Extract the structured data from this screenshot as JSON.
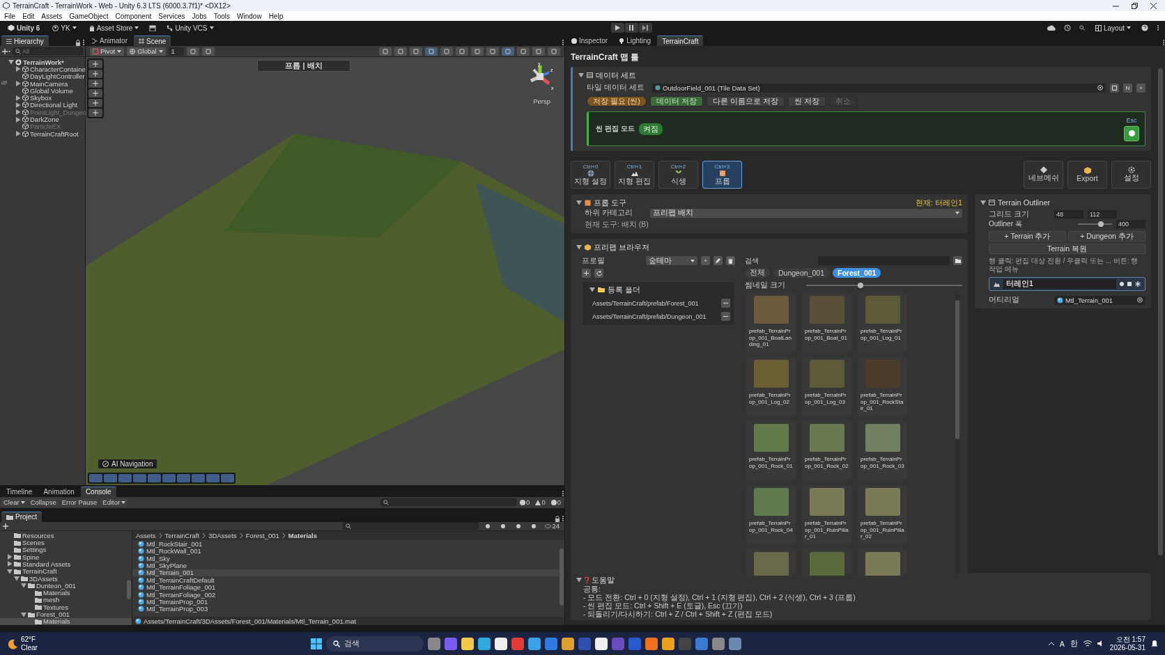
{
  "window": {
    "title": "TerrainCraft - TerrainWork - Web - Unity 6.3 LTS (6000.3.7f1)* <DX12>"
  },
  "menu": [
    "File",
    "Edit",
    "Assets",
    "GameObject",
    "Component",
    "Services",
    "Jobs",
    "Tools",
    "Window",
    "Help"
  ],
  "toolbar": {
    "product": "Unity 6",
    "account": "YK",
    "asset_store": "Asset Store",
    "vcs": "Unity VCS",
    "layout": "Layout"
  },
  "hierarchy": {
    "tab": "Hierarchy",
    "search_placeholder": "All",
    "root": {
      "label": "TerrainWork*",
      "expanded": true,
      "disabled": false,
      "children": [
        {
          "label": "CharacterContaine",
          "expanded": false,
          "disabled": false
        },
        {
          "label": "DayLightController",
          "disabled": false
        },
        {
          "label": "MainCamera",
          "expanded": false,
          "disabled": false
        },
        {
          "label": "Global Volume",
          "disabled": false
        },
        {
          "label": "Skybox",
          "expanded": false,
          "disabled": false
        },
        {
          "label": "Directional Light",
          "expanded": false,
          "disabled": false
        },
        {
          "label": "PointLight_Dungeo",
          "expanded": false,
          "disabled": true
        },
        {
          "label": "DarkZone",
          "expanded": false,
          "disabled": false
        },
        {
          "label": "ParticleEX",
          "disabled": true
        },
        {
          "label": "TerrainCraftRoot",
          "expanded": false,
          "disabled": false
        }
      ]
    }
  },
  "scene_tabs": [
    {
      "label": "Animator",
      "selected": false
    },
    {
      "label": "Scene",
      "selected": true
    }
  ],
  "scene_toolbar": {
    "pivot": "Pivot",
    "space": "Global",
    "grid_step": "1"
  },
  "scene_view": {
    "mode_label": "프롭 | 배치",
    "projection": "Persp",
    "axes": [
      "y",
      "z",
      "x"
    ],
    "overlay": "AI Navigation"
  },
  "console": {
    "tabs": [
      {
        "label": "Timeline",
        "selected": false
      },
      {
        "label": "Animation",
        "selected": false
      },
      {
        "label": "Console",
        "selected": true
      }
    ],
    "buttons": [
      "Clear",
      "Collapse",
      "Error Pause",
      "Editor"
    ],
    "counts": [
      "0",
      "0",
      "0"
    ]
  },
  "project": {
    "tab": "Project",
    "visible_count": "24",
    "tree": [
      {
        "label": "Resources",
        "selected": false
      },
      {
        "label": "Scenes",
        "selected": false
      },
      {
        "label": "Settings",
        "selected": false
      },
      {
        "label": "Spine",
        "expanded": false,
        "selected": false
      },
      {
        "label": "Standard Assets",
        "expanded": false,
        "selected": false
      },
      {
        "label": "TerrainCraft",
        "expanded": true,
        "selected": false,
        "children": [
          {
            "label": "3DAssets",
            "expanded": true,
            "selected": false,
            "children": [
              {
                "label": "Dunteon_001",
                "expanded": true,
                "selected": false,
                "children": [
                  {
                    "label": "Materials",
                    "selected": false
                  },
                  {
                    "label": "mesh",
                    "selected": false
                  },
                  {
                    "label": "Textures",
                    "selected": false
                  }
                ]
              },
              {
                "label": "Forest_001",
                "expanded": true,
                "selected": false,
                "children": [
                  {
                    "label": "Materials",
                    "selected": true
                  }
                ]
              }
            ]
          }
        ]
      }
    ],
    "breadcrumb": [
      "Assets",
      "TerrainCraft",
      "3DAssets",
      "Forest_001",
      "Materials"
    ],
    "files": [
      {
        "name": "Mtl_RockStair_001",
        "selected": false
      },
      {
        "name": "Mtl_RockWall_001",
        "selected": false
      },
      {
        "name": "Mtl_Sky",
        "selected": false
      },
      {
        "name": "Mtl_SkyPlane",
        "selected": false
      },
      {
        "name": "Mtl_Terrain_001",
        "selected": true
      },
      {
        "name": "Mtl_TerrainCraftDefault",
        "selected": false
      },
      {
        "name": "Mtl_TerrainFoliage_001",
        "selected": false
      },
      {
        "name": "Mtl_TerrainFoliage_002",
        "selected": false
      },
      {
        "name": "Mtl_TerrainProp_001",
        "selected": false
      },
      {
        "name": "Mtl_TerrainProp_003",
        "selected": false
      }
    ],
    "path": "Assets/TerrainCraft/3DAssets/Forest_001/Materials/Mtl_Terrain_001.mat"
  },
  "inspector": {
    "tabs": [
      {
        "label": "Inspector",
        "selected": false
      },
      {
        "label": "Lighting",
        "selected": false
      },
      {
        "label": "TerrainCraft",
        "selected": true
      }
    ],
    "title": "TerrainCraft 맵 툴",
    "data_set": {
      "header": "데이터 세트",
      "expanded": true,
      "field_label": "타일 데이터 세트",
      "field_value": "OutdoorField_001 (Tile Data Set)",
      "letter_button": "N",
      "add_button": "+",
      "actions": [
        {
          "label": "저장 필요 (씬)",
          "kind": "status",
          "disabled": false
        },
        {
          "label": "데이터 저장",
          "kind": "primary",
          "disabled": false
        },
        {
          "label": "다른 이름으로 저장",
          "kind": "normal",
          "disabled": false
        },
        {
          "label": "씬 저장",
          "kind": "normal",
          "disabled": false
        },
        {
          "label": "취소",
          "kind": "normal",
          "disabled": true
        }
      ],
      "edit_mode": {
        "label": "씬 편집 모드",
        "badge": "켜짐",
        "shortcut": "Esc",
        "on": true
      }
    },
    "modes": [
      {
        "shortcut": "Ctrl+0",
        "label": "지형 설정",
        "selected": false
      },
      {
        "shortcut": "Ctrl+1",
        "label": "지형 편집",
        "selected": false
      },
      {
        "shortcut": "Ctrl+2",
        "label": "식생",
        "selected": false
      },
      {
        "shortcut": "Ctrl+3",
        "label": "프롭",
        "selected": true
      }
    ],
    "tools": [
      "네브메쉬",
      "Export",
      "설정"
    ],
    "prop_tools": {
      "header": "프롭 도구",
      "expanded": true,
      "current": "현재: 터레인1",
      "category_label": "하위 카테고리",
      "category_value": "프리팹 배치",
      "tool_status": "현재 도구: 배치 (B)"
    },
    "prefab_browser": {
      "header": "프리팹 브라우저",
      "expanded": true,
      "profile_label": "프로필",
      "profile_value": "숲테마",
      "add_button": "+",
      "folders": {
        "header": "등록 폴더",
        "expanded": true,
        "paths": [
          "Assets/TerrainCraft/prefab/Forest_001",
          "Assets/TerrainCraft/prefab/Dungeon_001"
        ]
      },
      "search_label": "검색",
      "filters": [
        {
          "label": "전체",
          "selected": false
        },
        {
          "label": "Dungeon_001",
          "selected": false
        },
        {
          "label": "Forest_001",
          "selected": true
        }
      ],
      "thumb_label": "썸네일 크기",
      "thumb_size": {
        "level": 0.35
      },
      "items": [
        {
          "kind": "prefab",
          "name": "prefab_TerrainProp_001_BoatLanding_01"
        },
        {
          "kind": "prefab",
          "name": "prefab_TerrainProp_001_Boat_01"
        },
        {
          "kind": "prefab",
          "name": "prefab_TerrainProp_001_Log_01"
        },
        {
          "kind": "prefab",
          "name": "prefab_TerrainProp_001_Log_02"
        },
        {
          "kind": "prefab",
          "name": "prefab_TerrainProp_001_Log_03"
        },
        {
          "kind": "prefab",
          "name": "prefab_TerrainProp_001_RockStair_01"
        },
        {
          "kind": "prefab",
          "name": "prefab_TerrainProp_001_Rock_01"
        },
        {
          "kind": "prefab",
          "name": "prefab_TerrainProp_001_Rock_02"
        },
        {
          "kind": "prefab",
          "name": "prefab_TerrainProp_001_Rock_03"
        },
        {
          "kind": "prefab",
          "name": "prefab_TerrainProp_001_Rock_04"
        },
        {
          "kind": "prefab",
          "name": "prefab_TerrainProp_001_RuinPillar_01"
        },
        {
          "kind": "prefab",
          "name": "prefab_TerrainProp_001_RuinPillar_02"
        },
        {
          "kind": "clipped"
        },
        {
          "kind": "clipped"
        },
        {
          "kind": "clipped"
        }
      ]
    },
    "outliner": {
      "header": "Terrain Outliner",
      "expanded": true,
      "grid_label": "그리드 크기",
      "grid_values": [
        "48",
        "112"
      ],
      "width_label": "Outliner 폭",
      "width": {
        "level": 0.68
      },
      "width_value": "400",
      "buttons": [
        "+ Terrain 추가",
        "+ Dungeon 추가",
        "Terrain 복원"
      ],
      "hint": "행 클릭: 편집 대상 전환 / 우클릭 또는 ... 버튼: 행 작업 메뉴",
      "rows": [
        {
          "name": "터레인1",
          "selected": true
        }
      ],
      "material_label": "머티리얼",
      "material_value": "Mtl_Terrain_001"
    },
    "help": {
      "header": "도움말",
      "expanded": true,
      "lines": [
        "공통:",
        "- 모드 전환: Ctrl + 0 (지형 설정), Ctrl + 1 (지형 편집), Ctrl + 2 (식생), Ctrl + 3 (프롭)",
        "- 씬 편집 모드: Ctrl + Shift + E (토글), Esc (끄기)",
        "- 되돌리기/다시하기: Ctrl + Z / Ctrl + Shift + Z (편집 모드)"
      ]
    }
  },
  "taskbar": {
    "temperature": "62°F",
    "weather": "Clear",
    "search_placeholder": "검색",
    "input_mode": "A",
    "language": "한",
    "time": "오전 1:57",
    "date": "2026-05-31"
  }
}
